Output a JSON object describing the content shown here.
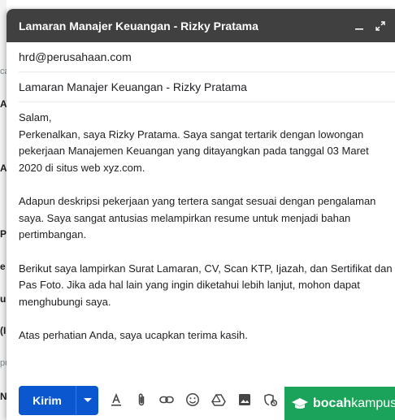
{
  "compose": {
    "title": "Lamaran Manajer Keuangan - Rizky Pratama",
    "to": "hrd@perusahaan.com",
    "subject": "Lamaran Manajer Keuangan - Rizky Pratama",
    "send_label": "Kirim"
  },
  "body": {
    "p1": "Salam,",
    "p2": "Perkenalkan, saya Rizky Pratama. Saya sangat tertarik dengan lowongan pekerjaan Manajemen Keuangan yang ditayangkan pada tanggal 03 Maret 2020 di situs web xyz.com.",
    "p3": "Adapun deskripsi pekerjaan yang tertera sangat sesuai dengan pengalaman saya. Saya sangat antusias melampirkan resume untuk menjadi bahan pertimbangan.",
    "p4": "Berikut saya lampirkan Surat Lamaran, CV, Scan KTP, Ijazah, dan Sertifikat dan Pas Foto. Jika ada hal lain yang ingin diketahui lebih lanjut, mohon dapat menghubungi saya.",
    "p5": "Atas perhatian Anda, saya ucapkan terima kasih."
  },
  "background": {
    "fragments": [
      "ca",
      "AT",
      "Al",
      "P",
      "e",
      "ur",
      "(I",
      "pu",
      "N"
    ]
  },
  "brand": {
    "name_bold": "bocah",
    "name_rest": "kampus"
  },
  "colors": {
    "header_bg": "#404040",
    "send_bg": "#0b57d0",
    "brand_bg": "#1ba35a",
    "spell_underline": "#d93025"
  },
  "icons": [
    "minimize-icon",
    "expand-icon",
    "dropdown-arrow-icon",
    "text-format-icon",
    "attach-icon",
    "link-icon",
    "emoji-icon",
    "drive-icon",
    "photo-icon",
    "confidential-icon",
    "graduation-cap-icon"
  ]
}
